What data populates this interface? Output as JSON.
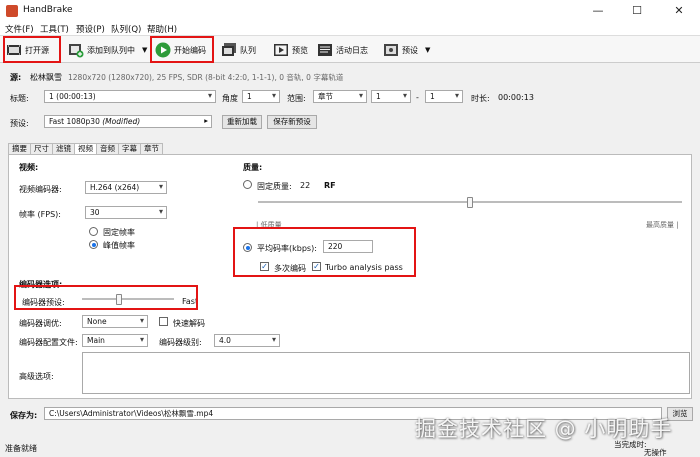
{
  "window": {
    "title": "HandBrake",
    "minimize": "—",
    "maximize": "☐",
    "close": "✕"
  },
  "menu": [
    "文件(F)",
    "工具(T)",
    "预设(P)",
    "队列(Q)",
    "帮助(H)"
  ],
  "toolbar": {
    "open_source": "打开源",
    "add_queue": "添加到队列中",
    "start_encode": "开始编码",
    "queue": "队列",
    "preview": "预览",
    "activity_log": "活动日志",
    "presets": "预设"
  },
  "source": {
    "label": "源:",
    "name": "松林飘雪",
    "info": "1280x720 (1280x720), 25 FPS, SDR (8-bit 4:2:0, 1-1-1), 0 音轨, 0 字幕轨道"
  },
  "title_row": {
    "title_label": "标题:",
    "title_value": "1 (00:00:13)",
    "angle_label": "角度",
    "angle_value": "1",
    "range_label": "范围:",
    "range_value": "章节",
    "range_from": "1",
    "range_sep": "-",
    "range_to": "1",
    "duration_label": "时长:",
    "duration_value": "00:00:13"
  },
  "preset_row": {
    "label": "预设:",
    "value": "Fast 1080p30",
    "modified": "(Modified)",
    "reload": "重新加载",
    "save_new": "保存新预设"
  },
  "tabs": [
    "摘要",
    "尺寸",
    "滤镜",
    "视频",
    "音频",
    "字幕",
    "章节"
  ],
  "active_tab": 3,
  "video": {
    "section": "视频:",
    "encoder_label": "视频编码器:",
    "encoder_value": "H.264 (x264)",
    "fps_label": "帧率 (FPS):",
    "fps_value": "30",
    "constant_fr": "固定帧率",
    "peak_fr": "峰值帧率"
  },
  "quality": {
    "section": "质量:",
    "cq_label": "固定质量:",
    "cq_value": "22",
    "cq_unit": "RF",
    "low_quality": "| 低质量",
    "high_quality": "最高质量 |",
    "slider_level": 0.5,
    "avg_bitrate_label": "平均码率(kbps):",
    "avg_bitrate_value": "220",
    "two_pass": "多次编码",
    "turbo": "Turbo analysis pass"
  },
  "encoder_options": {
    "section": "编码器选项:",
    "preset_label": "编码器预设:",
    "preset_value": "Fast",
    "preset_level": 0.4,
    "tune_label": "编码器调优:",
    "tune_value": "None",
    "fast_decode": "快速解码",
    "profile_label": "编码器配置文件:",
    "profile_value": "Main",
    "level_label": "编码器级别:",
    "level_value": "4.0",
    "advanced_label": "高级选项:"
  },
  "save": {
    "label": "保存为:",
    "path": "C:\\Users\\Administrator\\Videos\\松林飘雪.mp4",
    "browse": "浏览"
  },
  "status": {
    "ready": "准备就绪",
    "when_done_label": "当完成时:",
    "when_done_value": "无操作"
  },
  "watermark": "掘金技术社区 @ 小明助手",
  "colors": {
    "highlight": "#e31414",
    "accent": "#1a73e8"
  }
}
